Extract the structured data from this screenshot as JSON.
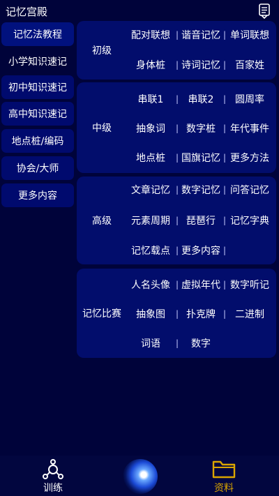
{
  "header": {
    "title": "记忆宫殿",
    "icon": "notebook-icon"
  },
  "sidebar": {
    "items": [
      {
        "label": "记忆法教程"
      },
      {
        "label": "小学知识速记"
      },
      {
        "label": "初中知识速记"
      },
      {
        "label": "高中知识速记"
      },
      {
        "label": "地点桩/编码"
      },
      {
        "label": "协会/大师"
      },
      {
        "label": "更多内容"
      }
    ]
  },
  "sections": [
    {
      "label": "初级",
      "rows": [
        [
          "配对联想",
          "谐音记忆",
          "单词联想"
        ],
        [
          "身体桩",
          "诗词记忆",
          "百家姓"
        ]
      ]
    },
    {
      "label": "中级",
      "rows": [
        [
          "串联1",
          "串联2",
          "圆周率"
        ],
        [
          "抽象词",
          "数字桩",
          "年代事件"
        ],
        [
          "地点桩",
          "国旗记忆",
          "更多方法"
        ]
      ]
    },
    {
      "label": "高级",
      "rows": [
        [
          "文章记忆",
          "数字记忆",
          "问答记忆"
        ],
        [
          "元素周期",
          "琵琶行",
          "记忆字典"
        ],
        [
          "记忆载点",
          "更多内容",
          ""
        ]
      ]
    },
    {
      "label": "记忆比赛",
      "rows": [
        [
          "人名头像",
          "虚拟年代",
          "数字听记"
        ],
        [
          "抽象图",
          "扑克牌",
          "二进制"
        ],
        [
          "词语",
          "数字"
        ]
      ]
    }
  ],
  "bottom_nav": {
    "train_label": "训练",
    "data_label": "资料",
    "train_icon": "network-hub-icon",
    "data_icon": "folder-icon",
    "center_icon": "orb-icon",
    "active_color": "#d9a400"
  },
  "separator": "|"
}
